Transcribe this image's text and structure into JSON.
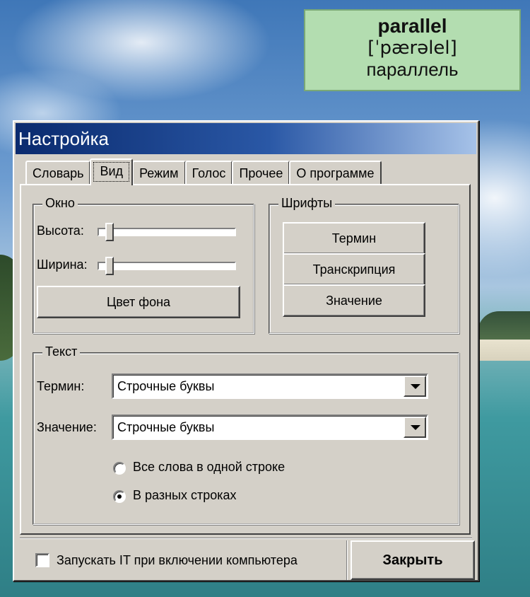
{
  "word_card": {
    "term": "parallel",
    "transcription": "[ˈpærəlel]",
    "translation": "параллель"
  },
  "window": {
    "title": "Настройка",
    "tabs": [
      {
        "label": "Словарь"
      },
      {
        "label": "Вид",
        "active": true
      },
      {
        "label": "Режим"
      },
      {
        "label": "Голос"
      },
      {
        "label": "Прочее"
      },
      {
        "label": "О программе"
      }
    ],
    "window_group": {
      "label": "Окно",
      "height_label": "Высота:",
      "height_value": 0.05,
      "width_label": "Ширина:",
      "width_value": 0.05,
      "bg_color_button": "Цвет фона"
    },
    "fonts_group": {
      "label": "Шрифты",
      "buttons": [
        "Термин",
        "Транскрипция",
        "Значение"
      ]
    },
    "text_group": {
      "label": "Текст",
      "term_label": "Термин:",
      "term_value": "Строчные буквы",
      "value_label": "Значение:",
      "value_value": "Строчные буквы",
      "radios": [
        {
          "label": "Все слова в одной строке",
          "checked": false
        },
        {
          "label": "В разных строках",
          "checked": true
        }
      ]
    },
    "footer": {
      "startup_checkbox_label": "Запускать IT при включении компьютера",
      "startup_checked": false,
      "close_button": "Закрыть"
    }
  }
}
